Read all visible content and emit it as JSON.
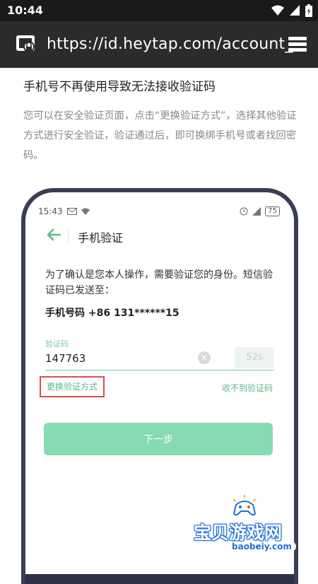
{
  "status_bar": {
    "time": "10:44"
  },
  "browser": {
    "url": "https://id.heytap.com/account_"
  },
  "article": {
    "heading": "手机号不再使用导致无法接收验证码",
    "paragraph": "您可以在安全验证页面，点击“更换验证方式”，选择其他验证方式进行安全验证，验证通过后，即可换绑手机号或者找回密码。"
  },
  "phone_screen": {
    "status_time": "15:43",
    "battery": "75",
    "title": "手机验证",
    "description": "为了确认是您本人操作，需要验证您的身份。短信验证码已发送至：",
    "phone_number": "手机号码 +86 131******15",
    "code_label": "验证码",
    "code_value": "147763",
    "countdown": "52s",
    "switch_method": "更换验证方式",
    "no_code": "收不到验证码",
    "next_button": "下一步"
  },
  "watermark": {
    "brand": "宝贝游戏网",
    "site": "baobeiy.com"
  },
  "colors": {
    "accent_green": "#5cb88c",
    "button_green": "#86dbb0",
    "highlight_red": "#e24a4a",
    "toolbar": "#2b2b2b"
  }
}
